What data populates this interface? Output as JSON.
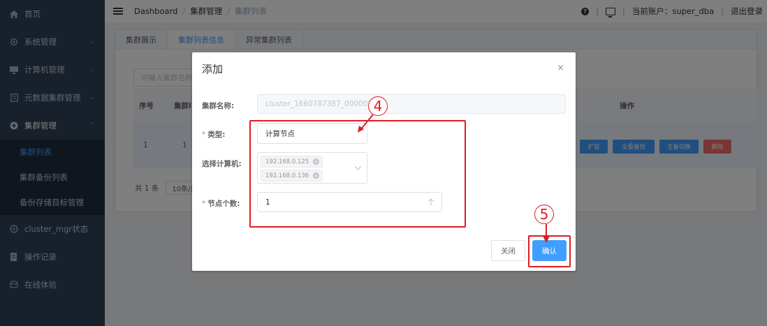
{
  "sidebar": {
    "items": [
      {
        "label": "首页",
        "icon": "home-icon"
      },
      {
        "label": "系统管理",
        "icon": "gear-icon"
      },
      {
        "label": "计算机管理",
        "icon": "monitor-icon"
      },
      {
        "label": "元数据集群管理",
        "icon": "database-icon"
      },
      {
        "label": "集群管理",
        "icon": "cluster-icon"
      },
      {
        "label": "cluster_mgr状态",
        "icon": "status-icon"
      },
      {
        "label": "操作记录",
        "icon": "record-icon"
      },
      {
        "label": "在线体验",
        "icon": "stack-icon"
      }
    ],
    "sub_items": [
      "集群列表",
      "集群备份列表",
      "备份存储目标管理"
    ]
  },
  "topbar": {
    "breadcrumb": [
      "Dashboard",
      "集群管理",
      "集群列表"
    ],
    "separator": "/",
    "account_label": "当前账户：super_dba",
    "logout_label": "退出登录"
  },
  "content": {
    "tabs": [
      "集群展示",
      "集群列表信息",
      "异常集群列表"
    ],
    "search_placeholder": "可输入集群名称",
    "columns": {
      "index": "序号",
      "cluster": "集群I",
      "ops": "操作"
    },
    "row": {
      "index": "1",
      "id": "1"
    },
    "op_buttons": [
      "扩容",
      "全量备份",
      "主备切换",
      "删除"
    ],
    "pager_total": "共 1 条",
    "pager_size": "10条/页"
  },
  "dialog": {
    "title": "添加",
    "close_glyph": "×",
    "cluster_name_label": "集群名称:",
    "cluster_name_value": "cluster_1660787387_000001",
    "type_label": "类型:",
    "type_value": "计算节点",
    "machine_label": "选择计算机:",
    "machine_tags": [
      "192.168.0.125",
      "192.168.0.136"
    ],
    "node_count_label": "节点个数:",
    "node_count_value": "1",
    "cancel_label": "关闭",
    "confirm_label": "确认",
    "required_mark": "*"
  },
  "annotations": {
    "step4": "4",
    "step5": "5",
    "color": "#e01b24"
  }
}
